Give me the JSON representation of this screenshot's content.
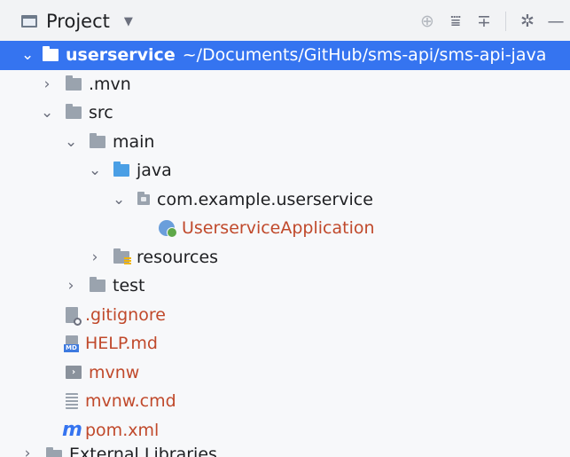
{
  "header": {
    "title": "Project",
    "tools": [
      "locate-icon",
      "expand-all-icon",
      "collapse-all-icon",
      "gear-icon",
      "hide-icon"
    ]
  },
  "tree": {
    "root": {
      "label": "userservice",
      "path": "~/Documents/GitHub/sms-api/sms-api-java"
    },
    "mvn": ".mvn",
    "src": "src",
    "main": "main",
    "java": "java",
    "package": "com.example.userservice",
    "app_class": "UserserviceApplication",
    "resources": "resources",
    "test": "test",
    "gitignore": ".gitignore",
    "help": "HELP.md",
    "mvnw": "mvnw",
    "mvnw_cmd": "mvnw.cmd",
    "pom": "pom.xml",
    "next_partial": "External Libraries"
  },
  "colors": {
    "selection": "#3574f0",
    "vcs_unversioned": "#c0492b",
    "source_folder": "#4a9fe5"
  }
}
